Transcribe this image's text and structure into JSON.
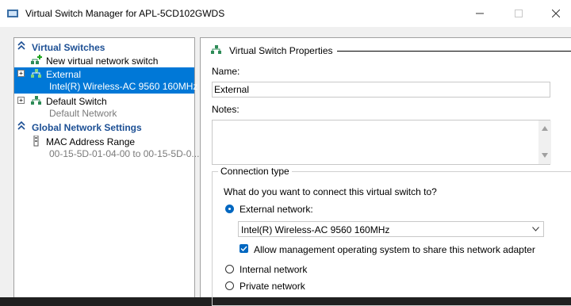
{
  "window": {
    "title": "Virtual Switch Manager for APL-5CD102GWDS",
    "icons": [
      "app-icon",
      "minimize-icon",
      "maximize-icon",
      "close-icon"
    ]
  },
  "left_pane": {
    "virtual_switches_header": "Virtual Switches",
    "new_switch_label": "New virtual network switch",
    "switches": [
      {
        "name": "External",
        "adapter": "Intel(R) Wireless-AC 9560 160MHz",
        "selected": true
      },
      {
        "name": "Default Switch",
        "adapter": "Default Network",
        "selected": false
      }
    ],
    "global_header": "Global Network Settings",
    "mac_label": "MAC Address Range",
    "mac_value": "00-15-5D-01-04-00 to 00-15-5D-0..."
  },
  "right_pane": {
    "header": "Virtual Switch Properties",
    "name_label": "Name:",
    "name_value": "External",
    "notes_label": "Notes:",
    "notes_value": "",
    "connection_type_title": "Connection type",
    "connection_question": "What do you want to connect this virtual switch to?",
    "external_label": "External network:",
    "external_adapter": "Intel(R) Wireless-AC 9560 160MHz",
    "allow_mgmt_label": "Allow management operating system to share this network adapter",
    "allow_mgmt_checked": true,
    "internal_label": "Internal network",
    "private_label": "Private network",
    "selected_connection": "External network"
  },
  "colors": {
    "selection": "#0078d7",
    "section_header": "#1c4f94",
    "accent": "#0067c0"
  }
}
